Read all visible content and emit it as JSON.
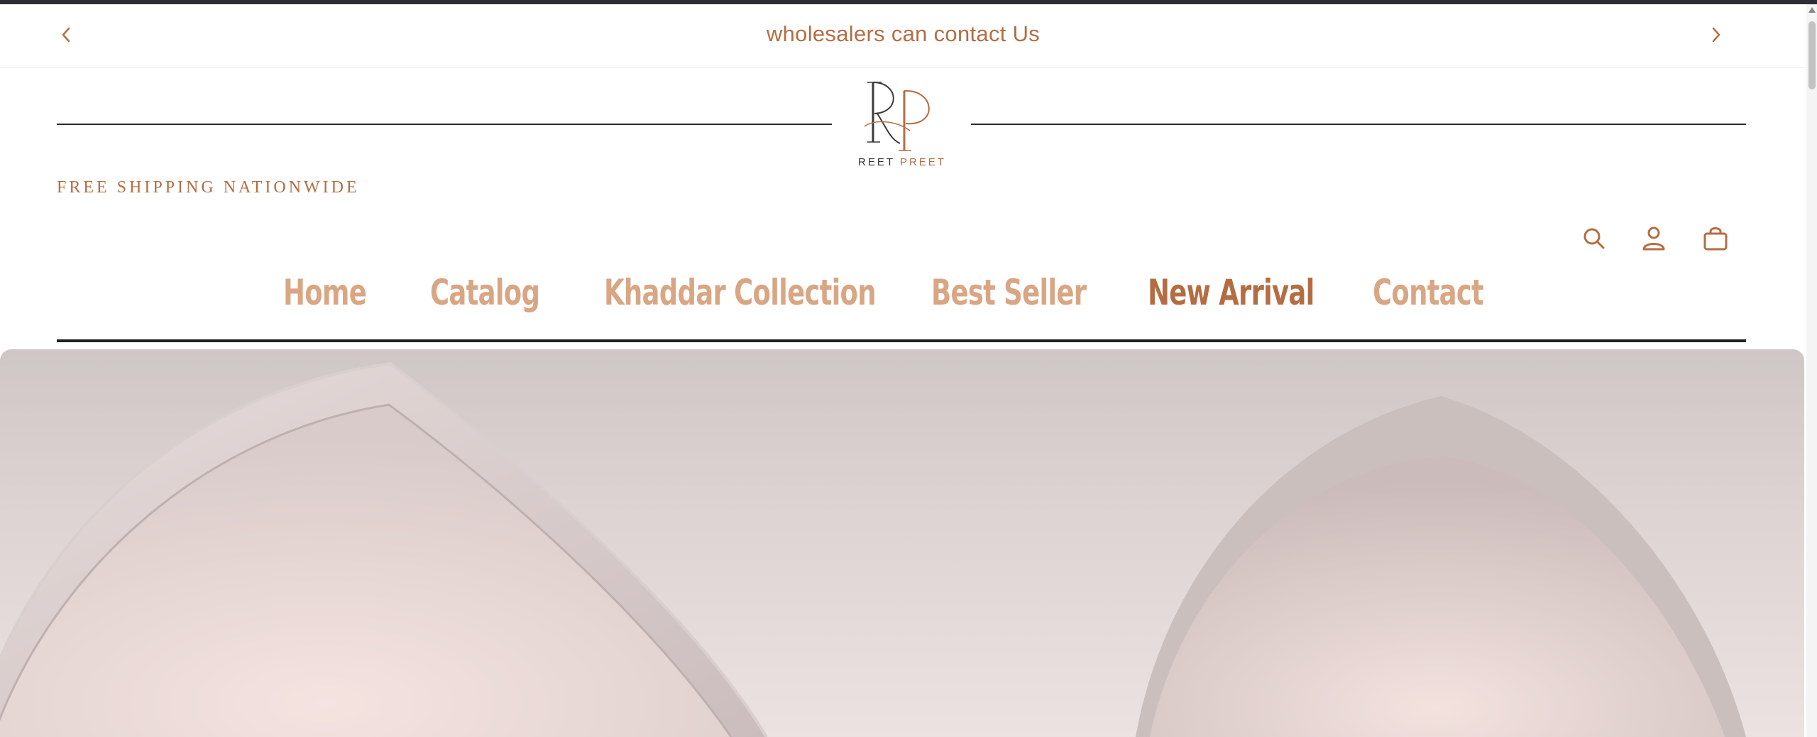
{
  "announcement": {
    "text": "wholesalers can contact Us",
    "prev_icon": "chevron-left-icon",
    "next_icon": "chevron-right-icon"
  },
  "brand": {
    "monogram": "RP",
    "name_first": "REET",
    "name_second": "PREET"
  },
  "header": {
    "shipping_text": "FREE SHIPPING NATIONWIDE",
    "icons": [
      "search-icon",
      "account-icon",
      "cart-icon"
    ]
  },
  "nav": {
    "items": [
      {
        "label": "Home"
      },
      {
        "label": "Catalog"
      },
      {
        "label": "Khaddar Collection"
      },
      {
        "label": "Best Seller"
      },
      {
        "label": "New Arrival"
      },
      {
        "label": "Contact"
      }
    ],
    "active": "New Arrival"
  },
  "colors": {
    "accent": "#b46d42",
    "nav_inactive": "#d9a684",
    "dark": "#2d2d33"
  }
}
